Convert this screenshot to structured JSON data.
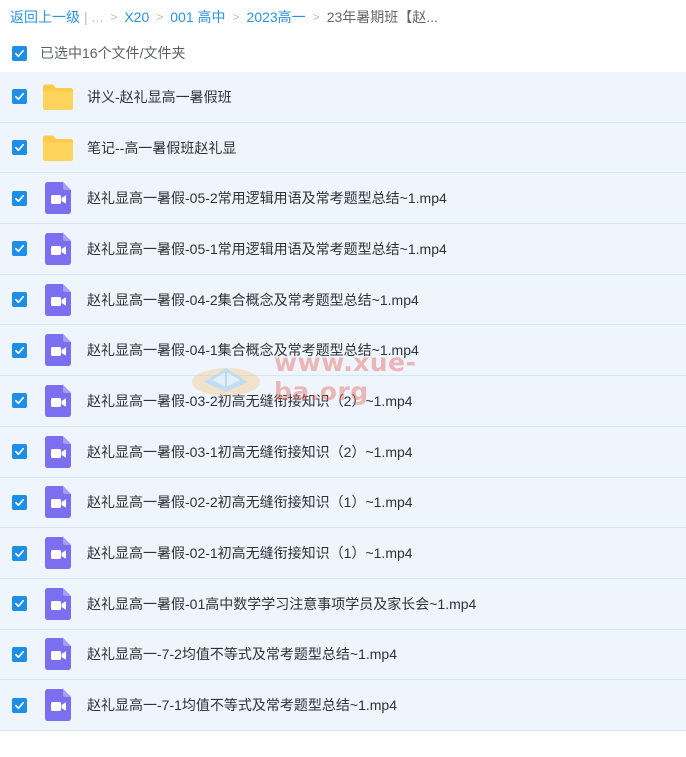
{
  "breadcrumb": {
    "back": "返回上一级",
    "sep1": "|",
    "ellipsis": "...",
    "items": [
      "X20",
      "001 高中",
      "2023高一"
    ],
    "current": "23年暑期班【赵..."
  },
  "select_all": {
    "label": "已选中16个文件/文件夹",
    "checked": true
  },
  "files": [
    {
      "type": "folder",
      "name": "讲义-赵礼显高一暑假班"
    },
    {
      "type": "folder",
      "name": "笔记--高一暑假班赵礼显"
    },
    {
      "type": "video",
      "name": "赵礼显高一暑假-05-2常用逻辑用语及常考题型总结~1.mp4"
    },
    {
      "type": "video",
      "name": "赵礼显高一暑假-05-1常用逻辑用语及常考题型总结~1.mp4"
    },
    {
      "type": "video",
      "name": "赵礼显高一暑假-04-2集合概念及常考题型总结~1.mp4"
    },
    {
      "type": "video",
      "name": "赵礼显高一暑假-04-1集合概念及常考题型总结~1.mp4"
    },
    {
      "type": "video",
      "name": "赵礼显高一暑假-03-2初高无缝衔接知识（2）~1.mp4"
    },
    {
      "type": "video",
      "name": "赵礼显高一暑假-03-1初高无缝衔接知识（2）~1.mp4"
    },
    {
      "type": "video",
      "name": "赵礼显高一暑假-02-2初高无缝衔接知识（1）~1.mp4"
    },
    {
      "type": "video",
      "name": "赵礼显高一暑假-02-1初高无缝衔接知识（1）~1.mp4"
    },
    {
      "type": "video",
      "name": "赵礼显高一暑假-01高中数学学习注意事项学员及家长会~1.mp4"
    },
    {
      "type": "video",
      "name": "赵礼显高一-7-2均值不等式及常考题型总结~1.mp4"
    },
    {
      "type": "video",
      "name": "赵礼显高一-7-1均值不等式及常考题型总结~1.mp4"
    }
  ],
  "watermark": {
    "text": "www.xue-ba.org"
  },
  "icons": {
    "folder": "folder-icon",
    "video": "video-file-icon",
    "check": "checkmark-icon"
  },
  "colors": {
    "accent": "#1f8ee6",
    "link": "#2a93e6",
    "row_selected_bg": "#eef5fd",
    "folder": "#ffc94a",
    "video": "#7b6ff0"
  }
}
